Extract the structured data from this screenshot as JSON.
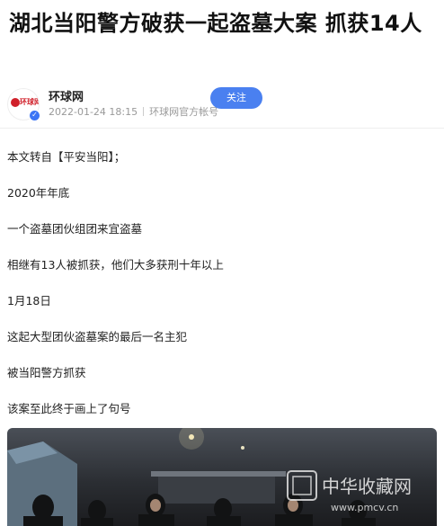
{
  "article": {
    "title": "湖北当阳警方破获一起盗墓大案 抓获14人"
  },
  "author": {
    "avatar_text": "环球网",
    "name": "环球网",
    "date": "2022-01-24 18:15",
    "tag": "环球网官方帐号",
    "follow_label": "关注"
  },
  "content": {
    "paragraphs": [
      "本文转自【平安当阳】；",
      "2020年年底",
      "一个盗墓团伙组团来宜盗墓",
      "相继有13人被抓获，他们大多获刑十年以上",
      "1月18日",
      "这起大型团伙盗墓案的最后一名主犯",
      "被当阳警方抓获",
      "该案至此终于画上了句号"
    ]
  },
  "watermark": {
    "text": "中华收藏网",
    "url": "www.pmcv.cn"
  },
  "colors": {
    "accent": "#4a80f0",
    "brand_red": "#d0202a",
    "meta_gray": "#999999"
  }
}
